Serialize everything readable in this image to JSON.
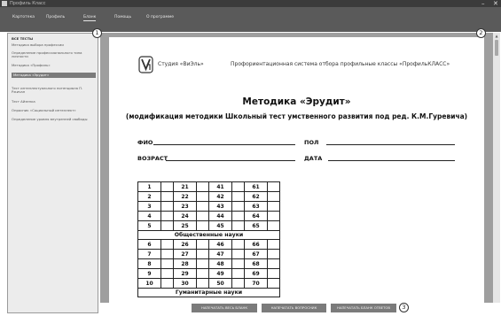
{
  "window": {
    "title": "Профиль Класс",
    "minimize": "–",
    "close": "✕"
  },
  "menu": {
    "items": [
      {
        "label": "Картотека"
      },
      {
        "label": "Профиль"
      },
      {
        "label": "Бланк",
        "active": true
      },
      {
        "label": "Помощь"
      },
      {
        "label": "О программе"
      }
    ]
  },
  "sidebar": {
    "items": [
      {
        "label": "ВСЕ ТЕСТЫ",
        "kind": "header"
      },
      {
        "label": "Методика выбора профессии"
      },
      {
        "label": "Определение профессионального типа личности"
      },
      {
        "label": "Методика «Профиль»"
      },
      {
        "label": "Методика «Эрудит»",
        "kind": "selected"
      },
      {
        "label": "Тест интеллектуального потенциала П. Ржичан"
      },
      {
        "label": "Тест Айзенка"
      },
      {
        "label": "Опросник «Социальный интеллект»"
      },
      {
        "label": "Определение уровня внутренней свободы"
      }
    ]
  },
  "badges": {
    "one": "1",
    "two": "2",
    "three": "3"
  },
  "document": {
    "studio": "Студия «ВиЭль»",
    "system": "Профориентационная система отбора профильные классы «ПрофильКЛАСС»",
    "title": "Методика «Эрудит»",
    "subtitle": "(модификация методики Школьный тест умственного развития под ред. К.М.Гуревича)",
    "fields": {
      "fio": "ФИО",
      "sex": "ПОЛ",
      "age": "ВОЗРАСТ",
      "date": "ДАТА"
    },
    "sections": {
      "social": "Общественные науки",
      "humanitarian": "Гуманитарные науки"
    },
    "block1": [
      [
        "1",
        "21",
        "41",
        "61"
      ],
      [
        "2",
        "22",
        "42",
        "62"
      ],
      [
        "3",
        "23",
        "43",
        "63"
      ],
      [
        "4",
        "24",
        "44",
        "64"
      ],
      [
        "5",
        "25",
        "45",
        "65"
      ]
    ],
    "block2": [
      [
        "6",
        "26",
        "46",
        "66"
      ],
      [
        "7",
        "27",
        "47",
        "67"
      ],
      [
        "8",
        "28",
        "48",
        "68"
      ],
      [
        "9",
        "29",
        "49",
        "69"
      ],
      [
        "10",
        "30",
        "50",
        "70"
      ]
    ]
  },
  "buttons": {
    "print_all": "НАПЕЧАТАТЬ ВЕСЬ БЛАНК",
    "print_questions": "НАПЕЧАТАТЬ ВОПРОСНИК",
    "print_answers": "НАПЕЧАТАТЬ БЛАНК ОТВЕТОВ"
  },
  "scroll_up_glyph": "▲",
  "colors": {
    "titlebar": "#3b3b3b",
    "menubar": "#5a5a5a",
    "viewer": "#9e9e9e",
    "button": "#7b7b7b",
    "selected": "#7a7a7a"
  }
}
